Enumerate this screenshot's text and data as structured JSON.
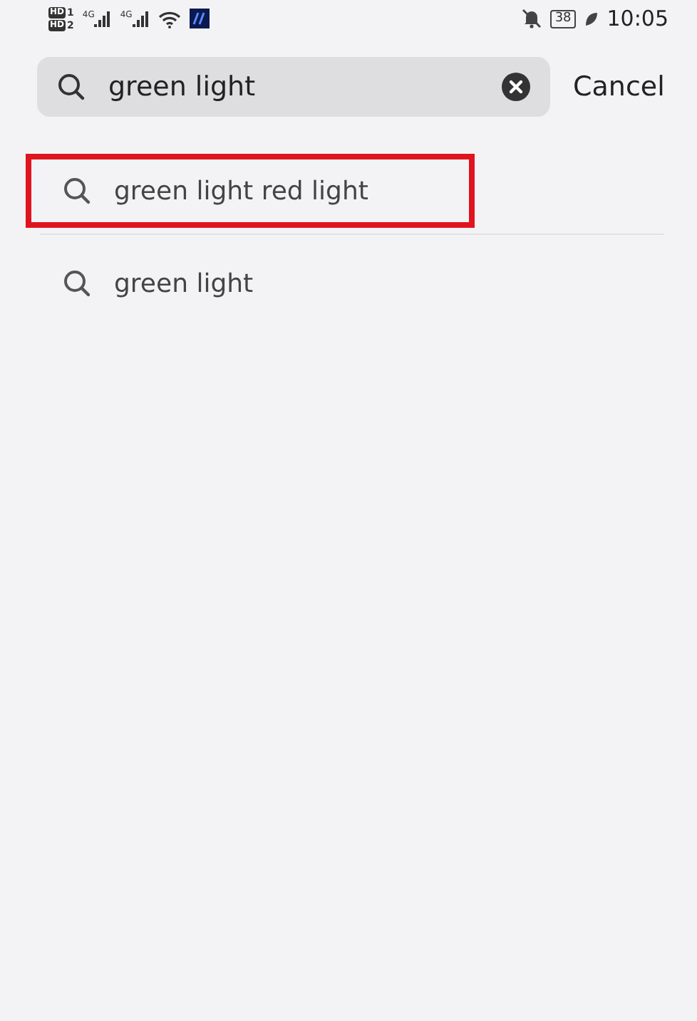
{
  "status_bar": {
    "sims": [
      {
        "badge": "HD",
        "slot": "1",
        "network": "4G"
      },
      {
        "badge": "HD",
        "slot": "2",
        "network": "4G"
      }
    ],
    "battery": "38",
    "time": "10:05"
  },
  "search": {
    "value": "green light",
    "cancel": "Cancel"
  },
  "suggestions": [
    {
      "text": "green light red light",
      "highlighted": true
    },
    {
      "text": "green light",
      "highlighted": false
    }
  ]
}
